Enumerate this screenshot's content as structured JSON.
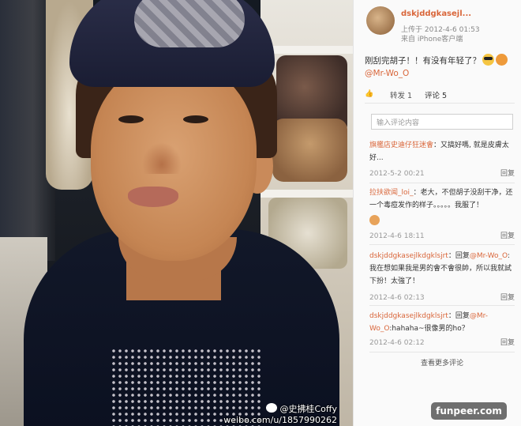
{
  "post": {
    "username": "dskjddgkasejl...",
    "posted_prefix": "上传于",
    "timestamp": "2012-4-6 01:53",
    "source": "来自 iPhone客户端",
    "text": "刚刮完胡子！！有没有年轻了？",
    "mention": "@Mr-Wo_O"
  },
  "actions": {
    "repost": "转发 1",
    "comment": "评论 5",
    "reply_placeholder": "输入评论内容"
  },
  "comments": [
    {
      "name": "旗艦店史迪仔狂迷會",
      "text": "：又搞好嗎, 就是皮膚太好...",
      "time": "2012-5-2 00:21",
      "reply": "回复"
    },
    {
      "name": "拉扶欲闻_loi_",
      "text": "：老大，不但胡子没刮干净，还一个毒痘发作的样子。。。。。我服了！",
      "time": "2012-4-6 18:11",
      "reply": "回复"
    },
    {
      "name": "dskjddgkasejlkdgklsjrt",
      "text": "：回复",
      "mention": "@Mr-Wo_O",
      "text2": ":我在想如果我是男的會不會很帥，所以我就試下扮！太強了！",
      "time": "2012-4-6 02:13",
      "reply": "回复"
    },
    {
      "name": "dskjddgkasejlkdgklsjrt",
      "text": "：回复",
      "mention": "@Mr-Wo_O",
      "text2": ":hahaha~很像男的ho？",
      "time": "2012-4-6 02:12",
      "reply": "回复"
    }
  ],
  "more_comments": "查看更多评论",
  "watermark": {
    "name": "@史拂桂Coffy",
    "url": "weibo.com/u/1857990262"
  },
  "badge": "funpeer.com",
  "colors": {
    "accent": "#d9663a",
    "badge_bg": "#6f6f6f"
  }
}
